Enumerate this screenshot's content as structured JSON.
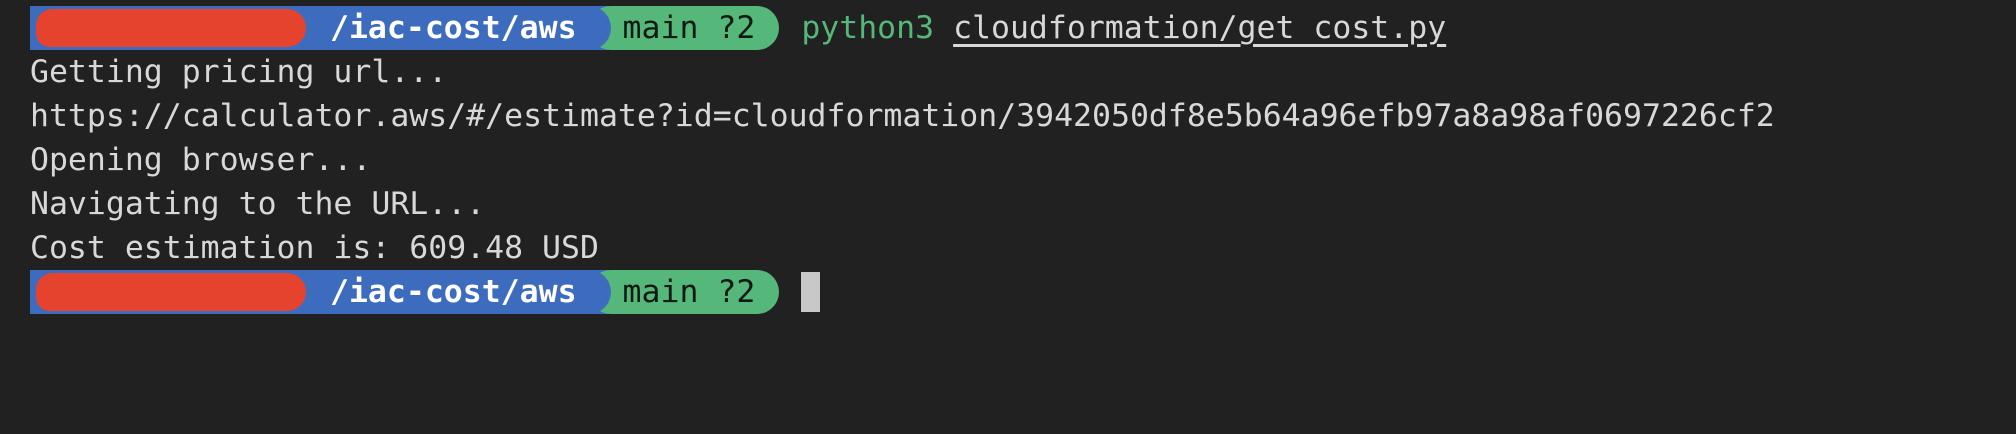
{
  "prompt": {
    "path": "/iac-cost/aws",
    "branch": "main ?2"
  },
  "command": {
    "program": "python3",
    "argument": "cloudformation/get_cost.py"
  },
  "output": [
    "Getting pricing url...",
    "https://calculator.aws/#/estimate?id=cloudformation/3942050df8e5b64a96efb97a8a98af0697226cf2",
    "Opening browser...",
    "Navigating to the URL...",
    "Cost estimation is: 609.48 USD"
  ],
  "colors": {
    "background": "#212121",
    "path_segment": "#3d6cbf",
    "git_segment": "#55b77a",
    "redaction": "#e5432d",
    "text": "#d8d8d8"
  }
}
